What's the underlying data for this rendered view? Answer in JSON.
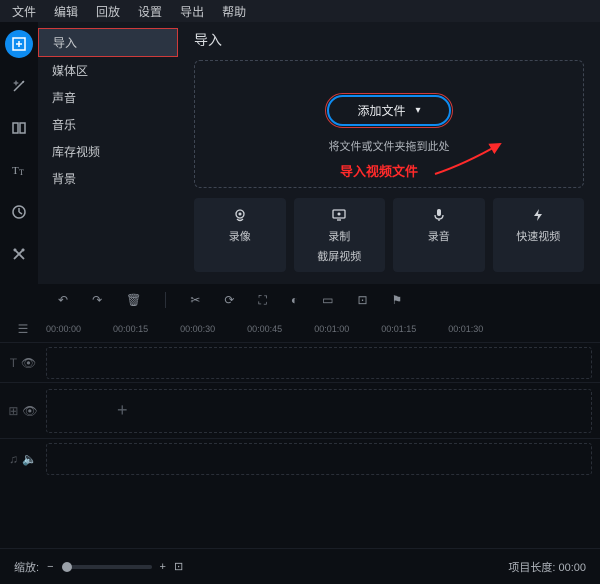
{
  "menubar": {
    "items": [
      "文件",
      "编辑",
      "回放",
      "设置",
      "导出",
      "帮助"
    ]
  },
  "sidebar": {
    "items": [
      "导入",
      "媒体区",
      "声音",
      "音乐",
      "库存视频",
      "背景"
    ]
  },
  "content": {
    "title": "导入",
    "add_file_label": "添加文件",
    "drop_hint": "将文件或文件夹拖到此处",
    "annotation": "导入视频文件"
  },
  "actions": {
    "record_cam": "录像",
    "record_screen_l1": "录制",
    "record_screen_l2": "截屏视频",
    "record_audio": "录音",
    "fast_video": "快速视频"
  },
  "timeline": {
    "marks": [
      "00:00:00",
      "00:00:15",
      "00:00:30",
      "00:00:45",
      "00:01:00",
      "00:01:15",
      "00:01:30"
    ]
  },
  "footer": {
    "zoom_label": "缩放:",
    "project_length_label": "项目长度:",
    "project_length_value": "00:00"
  }
}
